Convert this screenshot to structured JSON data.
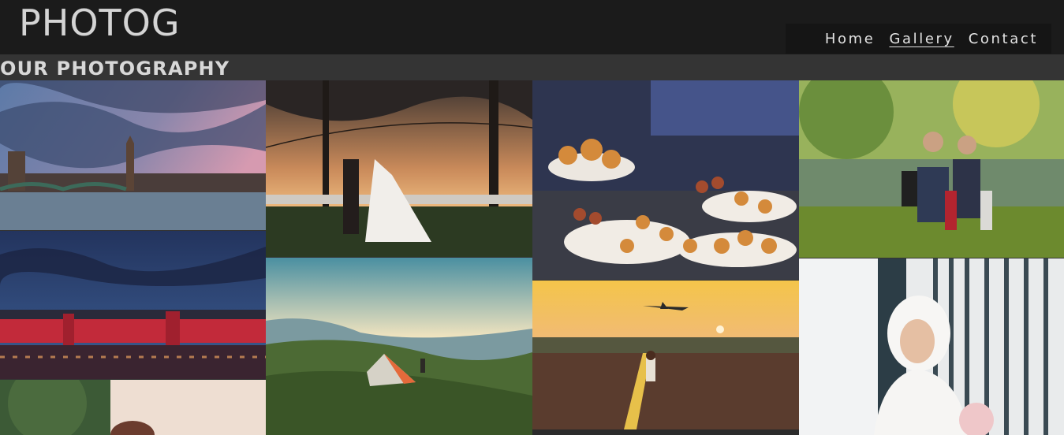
{
  "brand": {
    "name": "PHOTOG"
  },
  "nav": {
    "items": [
      {
        "label": "Home"
      },
      {
        "label": "Gallery"
      },
      {
        "label": "Contact"
      }
    ]
  },
  "gallery": {
    "title": "OUR PHOTOGRAPHY"
  }
}
